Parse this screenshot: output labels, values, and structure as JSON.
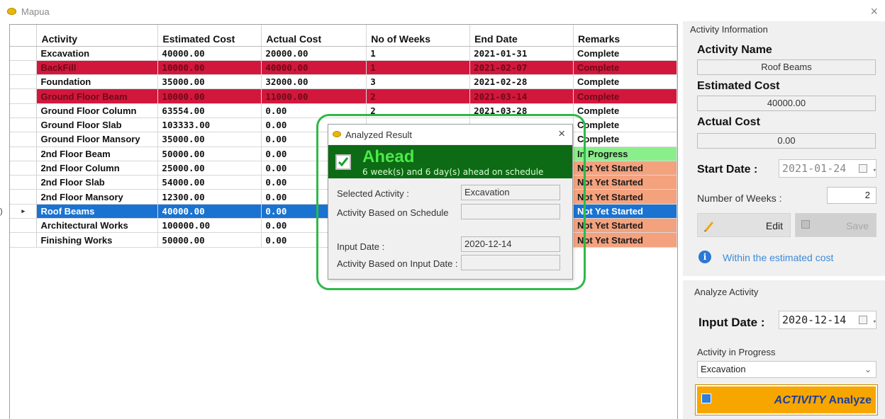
{
  "window": {
    "title": "Mapua",
    "close": "×"
  },
  "grid": {
    "columns": [
      "Activity",
      "Estimated Cost",
      "Actual Cost",
      "No of Weeks",
      "End Date",
      "Remarks"
    ],
    "rows": [
      {
        "activity": "Excavation",
        "estimated": "40000.00",
        "actual": "20000.00",
        "weeks": "1",
        "end": "2021-01-31",
        "remarks": "Complete",
        "style": "normal",
        "rstyle": ""
      },
      {
        "activity": "BackFill",
        "estimated": "10000.00",
        "actual": "40000.00",
        "weeks": "1",
        "end": "2021-02-07",
        "remarks": "Complete",
        "style": "red",
        "rstyle": ""
      },
      {
        "activity": "Foundation",
        "estimated": "35000.00",
        "actual": "32000.00",
        "weeks": "3",
        "end": "2021-02-28",
        "remarks": "Complete",
        "style": "normal",
        "rstyle": ""
      },
      {
        "activity": "Ground Floor Beam",
        "estimated": "10000.00",
        "actual": "11000.00",
        "weeks": "2",
        "end": "2021-03-14",
        "remarks": "Complete",
        "style": "red",
        "rstyle": ""
      },
      {
        "activity": "Ground Floor Column",
        "estimated": "63554.00",
        "actual": "0.00",
        "weeks": "2",
        "end": "2021-03-28",
        "remarks": "Complete",
        "style": "normal",
        "rstyle": ""
      },
      {
        "activity": "Ground Floor Slab",
        "estimated": "103333.00",
        "actual": "0.00",
        "weeks": "",
        "end": "",
        "remarks": "Complete",
        "style": "normal",
        "rstyle": ""
      },
      {
        "activity": "Ground Floor Mansory",
        "estimated": "35000.00",
        "actual": "0.00",
        "weeks": "",
        "end": "",
        "remarks": "Complete",
        "style": "normal",
        "rstyle": ""
      },
      {
        "activity": "2nd Floor Beam",
        "estimated": "50000.00",
        "actual": "0.00",
        "weeks": "",
        "end": "",
        "remarks": "In Progress",
        "style": "normal",
        "rstyle": "green"
      },
      {
        "activity": "2nd Floor Column",
        "estimated": "25000.00",
        "actual": "0.00",
        "weeks": "",
        "end": "",
        "remarks": "Not Yet Started",
        "style": "normal",
        "rstyle": "orange"
      },
      {
        "activity": "2nd Floor Slab",
        "estimated": "54000.00",
        "actual": "0.00",
        "weeks": "",
        "end": "",
        "remarks": "Not Yet Started",
        "style": "normal",
        "rstyle": "orange"
      },
      {
        "activity": "2nd Floor Mansory",
        "estimated": "12300.00",
        "actual": "0.00",
        "weeks": "",
        "end": "",
        "remarks": "Not Yet Started",
        "style": "normal",
        "rstyle": "orange"
      },
      {
        "activity": "Roof Beams",
        "estimated": "40000.00",
        "actual": "0.00",
        "weeks": "",
        "end": "",
        "remarks": "Not Yet Started",
        "style": "blue",
        "rstyle": "",
        "selected": true
      },
      {
        "activity": "Architectural Works",
        "estimated": "100000.00",
        "actual": "0.00",
        "weeks": "",
        "end": "",
        "remarks": "Not Yet Started",
        "style": "normal",
        "rstyle": "orange"
      },
      {
        "activity": "Finishing Works",
        "estimated": "50000.00",
        "actual": "0.00",
        "weeks": "",
        "end": "",
        "remarks": "Not Yet Started",
        "style": "normal",
        "rstyle": "orange"
      }
    ]
  },
  "activity_info": {
    "group_label": "Activity Information",
    "name_label": "Activity Name",
    "name_value": "Roof Beams",
    "estimated_label": "Estimated Cost",
    "estimated_value": "40000.00",
    "actual_label": "Actual Cost",
    "actual_value": "0.00",
    "start_label": "Start Date :",
    "start_value": "2021-01-24",
    "weeks_label": "Number of Weeks :",
    "weeks_value": "2",
    "edit_label": "Edit",
    "save_label": "Save",
    "status_text": "Within the estimated cost"
  },
  "analyze": {
    "group_label": "Analyze Activity",
    "input_label": "Input Date :",
    "input_value": "2020-12-14",
    "progress_label": "Activity in Progress",
    "progress_value": "Excavation",
    "button_word1": "ACTIVITY",
    "button_word2": "Analyze"
  },
  "dialog": {
    "title": "Analyzed Result",
    "close": "×",
    "status": "Ahead",
    "status_sub": "6 week(s) and 6 day(s) ahead on schedule",
    "selected_label": "Selected Activity :",
    "selected_value": "Excavation",
    "schedule_label": "Activity Based on Schedule",
    "schedule_value": "",
    "input_date_label": "Input Date :",
    "input_date_value": "2020-12-14",
    "input_based_label": "Activity Based on Input Date :",
    "input_based_value": ""
  },
  "colors": {
    "over_budget_row": "#d2173c",
    "selected_row": "#1a73d1",
    "in_progress": "#8aef8a",
    "not_started": "#f4a27e",
    "dialog_banner": "#0c6b14",
    "highlight_ring": "#2fb84a",
    "analyze_button": "#f7a600"
  }
}
